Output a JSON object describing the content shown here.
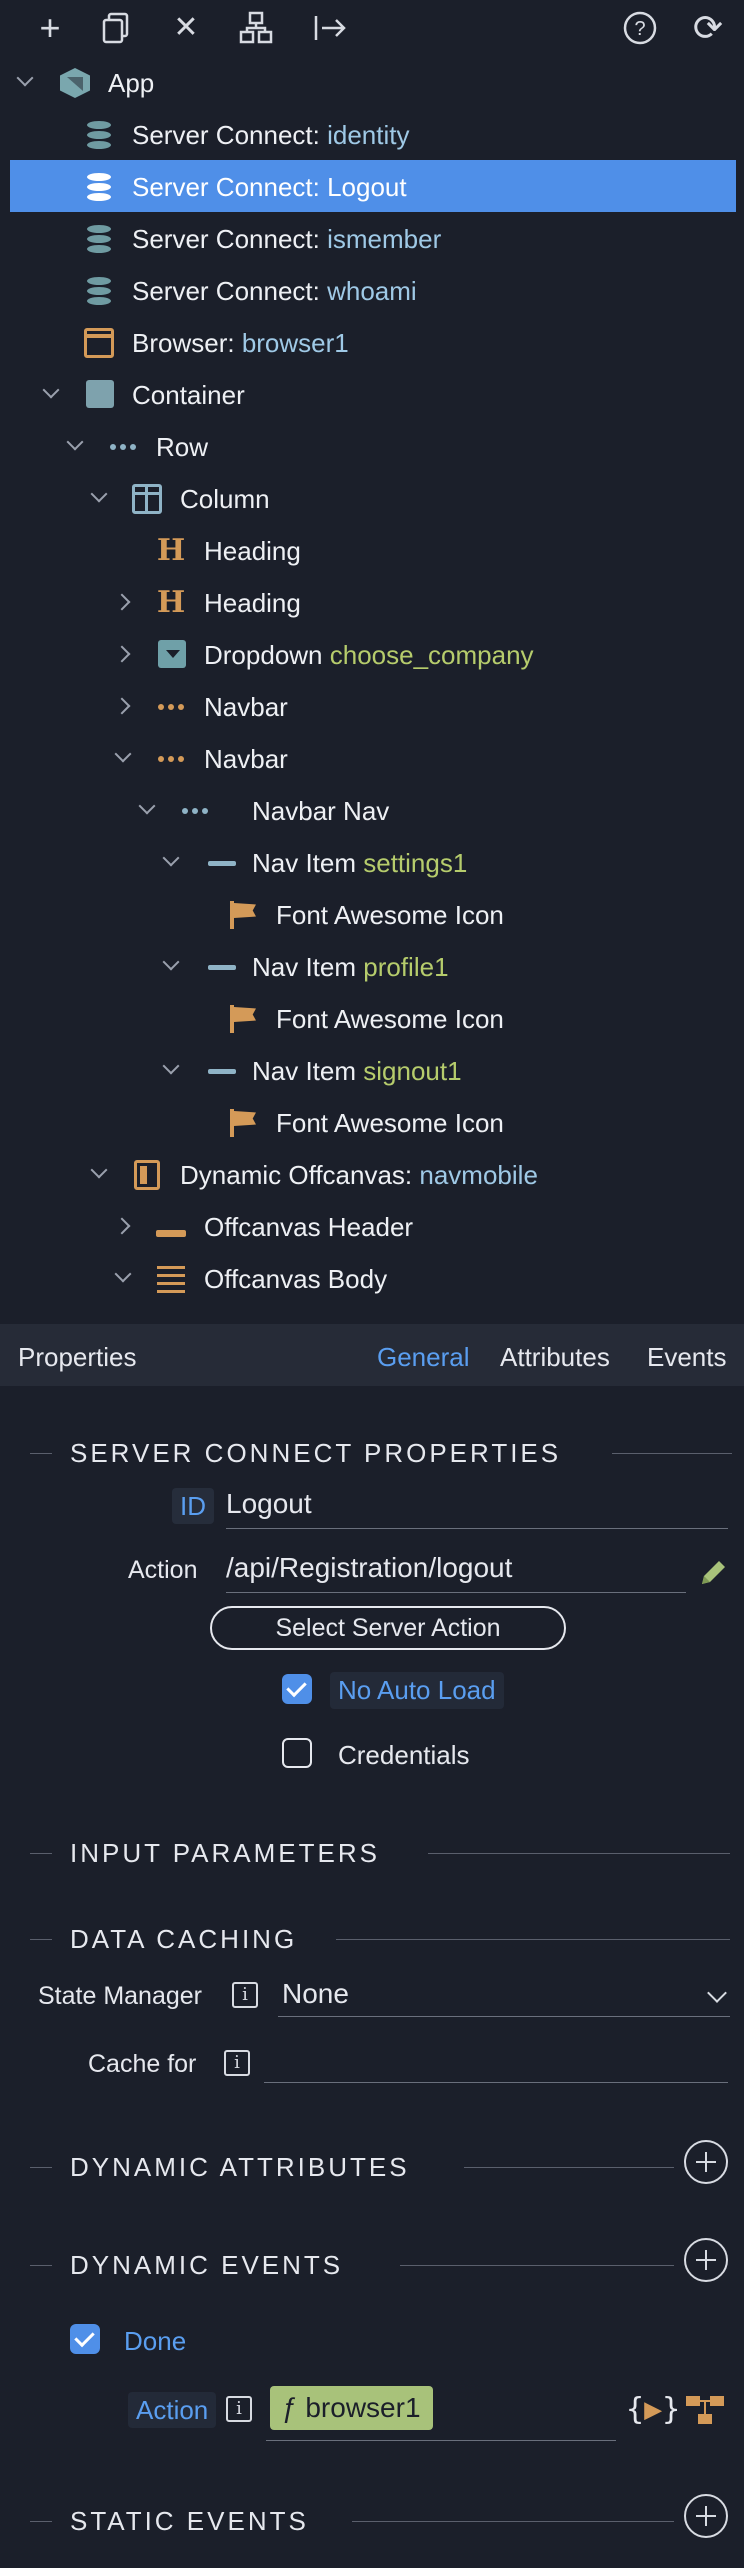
{
  "toolbar": {
    "icons": [
      "add-icon",
      "copy-icon",
      "delete-icon",
      "hierarchy-icon",
      "move-into-icon",
      "help-icon",
      "refresh-icon"
    ],
    "glyphs": {
      "add": "+",
      "delete": "✕",
      "help": "?",
      "refresh": "⟳"
    }
  },
  "tree": {
    "rows": [
      {
        "label": "App",
        "name": ""
      },
      {
        "label": "Server Connect: ",
        "name": "identity"
      },
      {
        "label": "Server Connect: Logout",
        "name": ""
      },
      {
        "label": "Server Connect: ",
        "name": "ismember"
      },
      {
        "label": "Server Connect: ",
        "name": "whoami"
      },
      {
        "label": "Browser: ",
        "name": "browser1"
      },
      {
        "label": "Container",
        "name": ""
      },
      {
        "label": "Row",
        "name": ""
      },
      {
        "label": "Column",
        "name": ""
      },
      {
        "label": "Heading",
        "name": ""
      },
      {
        "label": "Heading",
        "name": ""
      },
      {
        "label": "Dropdown ",
        "name": "choose_company"
      },
      {
        "label": "Navbar",
        "name": ""
      },
      {
        "label": "Navbar",
        "name": ""
      },
      {
        "label": "Navbar Nav",
        "name": ""
      },
      {
        "label": "Nav Item ",
        "name": "settings1"
      },
      {
        "label": "Font Awesome Icon",
        "name": ""
      },
      {
        "label": "Nav Item ",
        "name": "profile1"
      },
      {
        "label": "Font Awesome Icon",
        "name": ""
      },
      {
        "label": "Nav Item ",
        "name": "signout1"
      },
      {
        "label": "Font Awesome Icon",
        "name": ""
      },
      {
        "label": "Dynamic Offcanvas: ",
        "name": "navmobile"
      },
      {
        "label": "Offcanvas Header",
        "name": ""
      },
      {
        "label": "Offcanvas Body",
        "name": ""
      }
    ]
  },
  "properties": {
    "title": "Properties",
    "tabs": [
      "General",
      "Attributes",
      "Events"
    ],
    "active_tab": "General",
    "sections": {
      "server_connect": "SERVER CONNECT PROPERTIES",
      "input_parameters": "INPUT PARAMETERS",
      "data_caching": "DATA CACHING",
      "dynamic_attributes": "DYNAMIC ATTRIBUTES",
      "dynamic_events": "DYNAMIC EVENTS",
      "static_events": "STATIC EVENTS"
    },
    "id_label": "ID",
    "id_value": "Logout",
    "action_label": "Action",
    "action_value": "/api/Registration/logout",
    "select_server_action": "Select Server Action",
    "no_auto_load_label": "No Auto Load",
    "no_auto_load_checked": true,
    "credentials_label": "Credentials",
    "credentials_checked": false,
    "state_manager_label": "State Manager",
    "state_manager_value": "None",
    "cache_for_label": "Cache for",
    "cache_for_value": "",
    "info_glyph": "i",
    "done_label": "Done",
    "done_checked": true,
    "event_action_label": "Action",
    "event_action_value": "ƒ browser1",
    "braces_open": "{",
    "braces_close": "}",
    "accent_color": "#4f8fe8"
  }
}
